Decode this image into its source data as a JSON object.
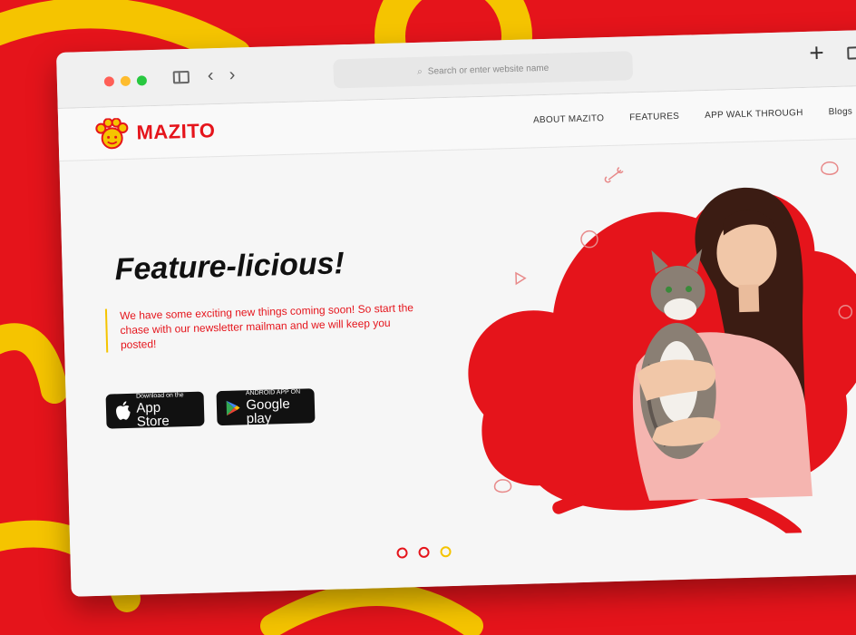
{
  "browser": {
    "address_placeholder": "Search or enter website name"
  },
  "site": {
    "brand": "MAZITO",
    "nav": [
      {
        "label": "ABOUT MAZITO"
      },
      {
        "label": "FEATURES"
      },
      {
        "label": "APP WALK THROUGH"
      },
      {
        "label": "Blogs"
      }
    ]
  },
  "hero": {
    "title": "Feature-licious!",
    "tagline": "We have some exciting new things coming soon! So start the chase with our newsletter mailman and we will keep you posted!",
    "app_store": {
      "small": "Download on the",
      "big": "App Store"
    },
    "google_play": {
      "small": "ANDROID APP ON",
      "big": "Google play"
    }
  },
  "carousel": {
    "dots": 3,
    "active_index": 2
  },
  "colors": {
    "brand_red": "#e5141b",
    "accent_yellow": "#f5c400",
    "page_bg": "#f6f6f6"
  }
}
